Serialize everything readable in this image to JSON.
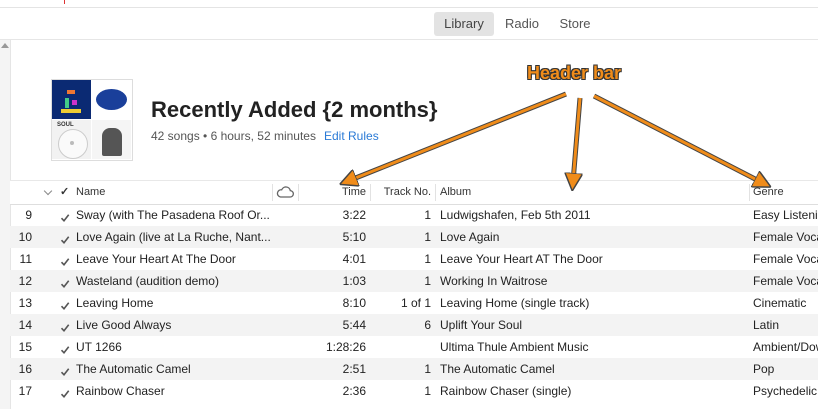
{
  "nav": {
    "tabs": [
      {
        "label": "Library",
        "active": true
      },
      {
        "label": "Radio",
        "active": false
      },
      {
        "label": "Store",
        "active": false
      }
    ]
  },
  "playlist": {
    "title": "Recently Added {2 months}",
    "meta": "42 songs • 6 hours, 52 minutes",
    "edit_rules": "Edit Rules"
  },
  "columns": {
    "check": "✓",
    "name": "Name",
    "cloud_icon": "cloud-icon",
    "time": "Time",
    "track": "Track No.",
    "album": "Album",
    "genre": "Genre"
  },
  "rows": [
    {
      "num": "9",
      "checked": true,
      "name": "Sway (with The Pasadena Roof Or...",
      "time": "3:22",
      "track": "1",
      "album": "Ludwigshafen, Feb 5th 2011",
      "genre": "Easy Listening"
    },
    {
      "num": "10",
      "checked": true,
      "name": "Love Again (live at La Ruche, Nant...",
      "time": "5:10",
      "track": "1",
      "album": "Love Again",
      "genre": "Female Vocal"
    },
    {
      "num": "11",
      "checked": true,
      "name": "Leave Your Heart At The Door",
      "time": "4:01",
      "track": "1",
      "album": "Leave Your Heart AT The Door",
      "genre": "Female Vocal"
    },
    {
      "num": "12",
      "checked": true,
      "name": "Wasteland (audition demo)",
      "time": "1:03",
      "track": "1",
      "album": "Working In Waitrose",
      "genre": "Female Vocal"
    },
    {
      "num": "13",
      "checked": true,
      "name": "Leaving Home",
      "time": "8:10",
      "track": "1 of 1",
      "album": "Leaving Home (single track)",
      "genre": "Cinematic"
    },
    {
      "num": "14",
      "checked": true,
      "name": "Live Good Always",
      "time": "5:44",
      "track": "6",
      "album": "Uplift Your Soul",
      "genre": "Latin"
    },
    {
      "num": "15",
      "checked": true,
      "name": "UT 1266",
      "time": "1:28:26",
      "track": "",
      "album": "Ultima Thule Ambient Music",
      "genre": "Ambient/Down"
    },
    {
      "num": "16",
      "checked": true,
      "name": "The Automatic Camel",
      "time": "2:51",
      "track": "1",
      "album": "The Automatic Camel",
      "genre": "Pop"
    },
    {
      "num": "17",
      "checked": true,
      "name": "Rainbow Chaser",
      "time": "2:36",
      "track": "1",
      "album": "Rainbow Chaser (single)",
      "genre": "Psychedelic"
    }
  ],
  "annotation": {
    "text": "Header bar",
    "color": "#f08c1a"
  },
  "colors": {
    "accent_link": "#2a7ad6",
    "row_alt": "#f3f3f3",
    "tab_active_bg": "#e3e3e3"
  }
}
